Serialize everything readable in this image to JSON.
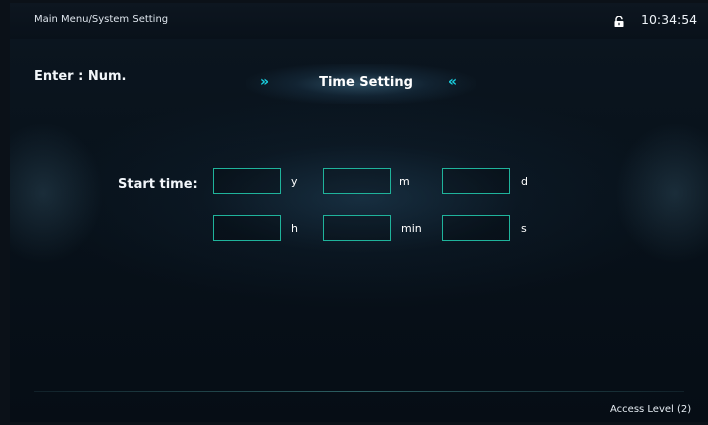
{
  "header": {
    "breadcrumb": "Main Menu/System Setting",
    "time": "10:34:54",
    "lock_icon": "lock-icon"
  },
  "enter_hint": "Enter : Num.",
  "title": {
    "left_chevron": "»",
    "text": "Time Setting",
    "right_chevron": "«"
  },
  "start_time": {
    "label": "Start time:",
    "fields": [
      {
        "unit": "y",
        "value": ""
      },
      {
        "unit": "m",
        "value": ""
      },
      {
        "unit": "d",
        "value": ""
      },
      {
        "unit": "h",
        "value": ""
      },
      {
        "unit": "min",
        "value": ""
      },
      {
        "unit": "s",
        "value": ""
      }
    ]
  },
  "footer": {
    "access_level": "Access Level  (2)"
  },
  "colors": {
    "accent": "#19d0e0",
    "field_border": "#1fb39b",
    "background": "#08121b"
  }
}
